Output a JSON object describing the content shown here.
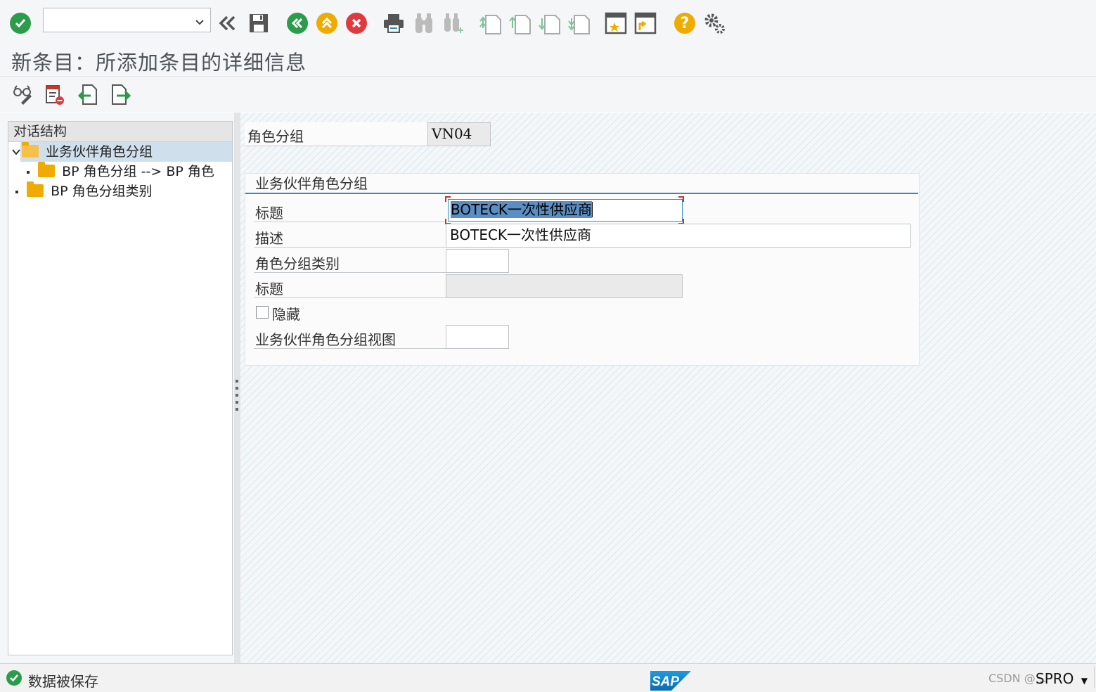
{
  "toolbar": {
    "command_field": {
      "value": "",
      "placeholder": ""
    },
    "buttons": [
      "enter-icon",
      "back-history-icon",
      "save-icon",
      "back-icon",
      "exit-icon",
      "cancel-icon",
      "print-icon",
      "find-icon",
      "find-next-icon",
      "first-page-icon",
      "previous-page-icon",
      "next-page-icon",
      "last-page-icon",
      "create-session-icon",
      "shortcut-icon",
      "help-icon",
      "settings-icon"
    ]
  },
  "title": "新条目：所添加条目的详细信息",
  "app_toolbar": [
    "display-change-icon",
    "delete-icon",
    "previous-entry-icon",
    "next-entry-icon"
  ],
  "dialog_structure": {
    "header": "对话结构",
    "items": [
      {
        "label": "业务伙伴角色分组",
        "level": 0,
        "expanded": true,
        "selected": true,
        "open_folder": true
      },
      {
        "label": "BP 角色分组 --> BP 角色",
        "level": 1,
        "expanded": false,
        "selected": false,
        "open_folder": false
      },
      {
        "label": "BP 角色分组类别",
        "level": 0,
        "expanded": false,
        "selected": false,
        "open_folder": false
      }
    ]
  },
  "key_field": {
    "label": "角色分组",
    "value": "VN04"
  },
  "group": {
    "title": "业务伙伴角色分组",
    "fields": {
      "title": {
        "label": "标题",
        "value": "BOTECK一次性供应商"
      },
      "description": {
        "label": "描述",
        "value": "BOTECK一次性供应商"
      },
      "category": {
        "label": "角色分组类别",
        "value": ""
      },
      "category_title": {
        "label": "标题",
        "value": ""
      },
      "hidden": {
        "label": "隐藏",
        "checked": false
      },
      "view": {
        "label": "业务伙伴角色分组视图",
        "value": ""
      }
    }
  },
  "status": {
    "message": "数据被保存",
    "tcode": "SPRO",
    "watermark": "CSDN @…"
  },
  "colors": {
    "accent": "#2b8bbd",
    "ok_green": "#2b9c4a",
    "warn_orange": "#f0ab00",
    "error_red": "#e03a3e",
    "folder": "#f0ab00"
  }
}
